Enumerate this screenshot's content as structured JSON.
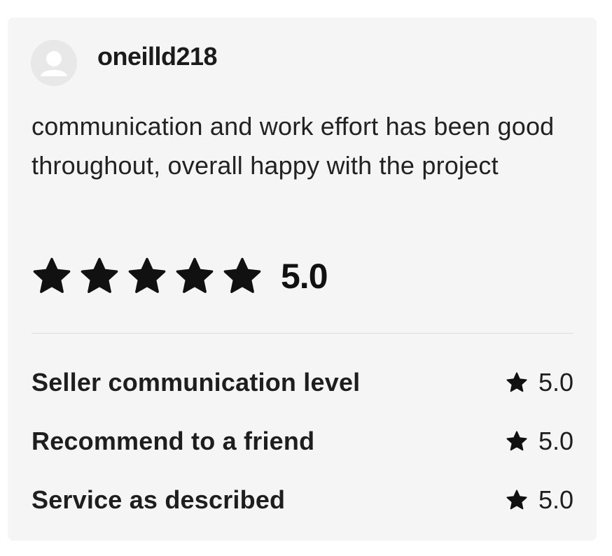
{
  "review": {
    "username": "oneilld218",
    "avatar_icon": "user-avatar-icon",
    "text": "communication and work effort has been good throughout, overall happy with the project",
    "overall_rating": "5.0",
    "overall_stars": 5,
    "star_icon": "star-icon",
    "colors": {
      "card_background": "#f5f5f5",
      "star": "#111111",
      "avatar": "#e8e8e8"
    },
    "sub_ratings": [
      {
        "label": "Seller communication level",
        "value": "5.0"
      },
      {
        "label": "Recommend to a friend",
        "value": "5.0"
      },
      {
        "label": "Service as described",
        "value": "5.0"
      }
    ]
  }
}
